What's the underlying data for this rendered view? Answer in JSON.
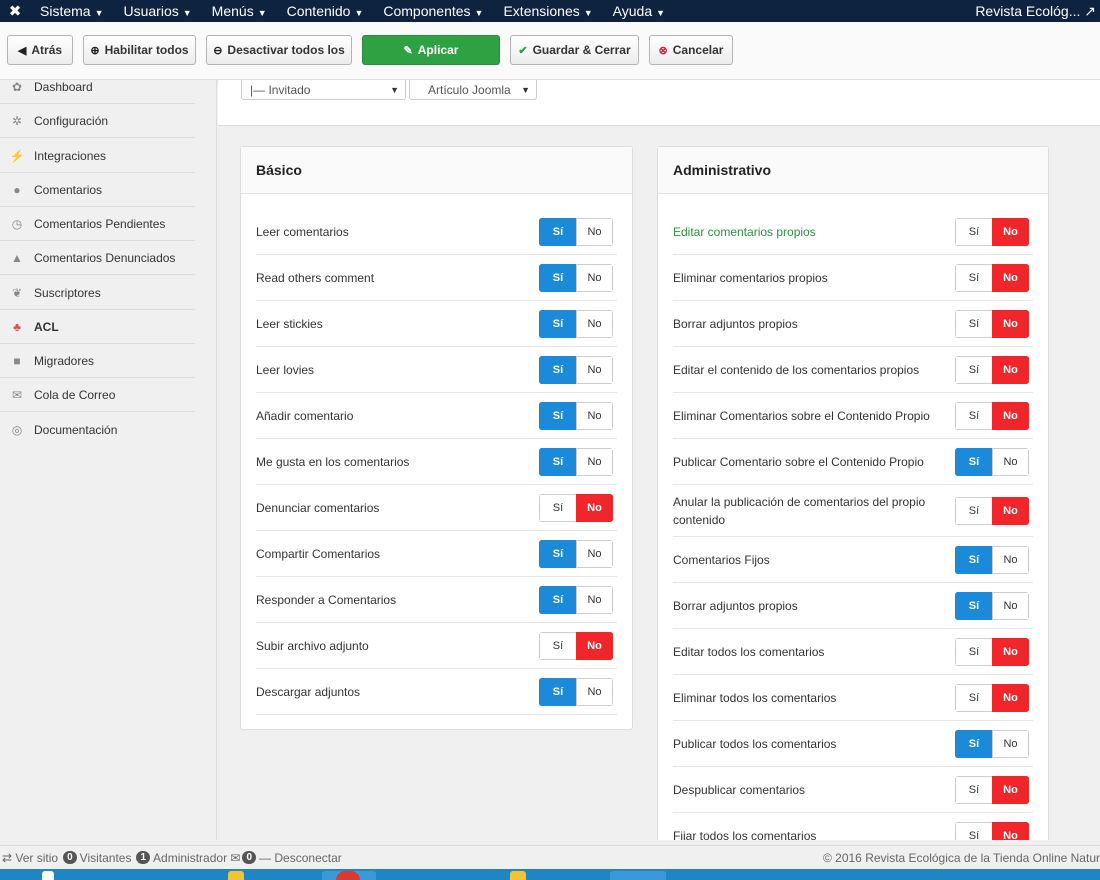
{
  "topnav": {
    "logo_icon": "joomla-icon",
    "menus": [
      "Sistema",
      "Usuarios",
      "Menús",
      "Contenido",
      "Componentes",
      "Extensiones",
      "Ayuda"
    ],
    "site_name": "Revista Ecológ...",
    "external_icon": "↗"
  },
  "toolbar": {
    "back": "Atrás",
    "enable_all": "Habilitar todos",
    "disable_all": "Desactivar todos los",
    "apply": "Aplicar",
    "save_close": "Guardar & Cerrar",
    "cancel": "Cancelar"
  },
  "sidebar": {
    "items": [
      {
        "label": "Dashboard",
        "icon": "dashboard-icon",
        "glyph": "✿"
      },
      {
        "label": "Configuración",
        "icon": "gear-icon",
        "glyph": "✲"
      },
      {
        "label": "Integraciones",
        "icon": "plug-icon",
        "glyph": "⚡"
      },
      {
        "label": "Comentarios",
        "icon": "comment-icon",
        "glyph": "●"
      },
      {
        "label": "Comentarios Pendientes",
        "icon": "clock-icon",
        "glyph": "◷"
      },
      {
        "label": "Comentarios Denunciados",
        "icon": "warning-icon",
        "glyph": "▲"
      },
      {
        "label": "Suscriptores",
        "icon": "leaf-icon",
        "glyph": "❦"
      },
      {
        "label": "ACL",
        "icon": "users-icon",
        "glyph": "♣"
      },
      {
        "label": "Migradores",
        "icon": "truck-icon",
        "glyph": "■"
      },
      {
        "label": "Cola de Correo",
        "icon": "mail-icon",
        "glyph": "✉"
      },
      {
        "label": "Documentación",
        "icon": "help-icon",
        "glyph": "◎"
      }
    ]
  },
  "filters": {
    "group": "|— Invitado",
    "content": "Artículo Joomla"
  },
  "basic": {
    "title": "Básico",
    "rows": [
      {
        "label": "Leer comentarios",
        "value": "si"
      },
      {
        "label": "Read others comment",
        "value": "si"
      },
      {
        "label": "Leer stickies",
        "value": "si"
      },
      {
        "label": "Leer lovies",
        "value": "si"
      },
      {
        "label": "Añadir comentario",
        "value": "si"
      },
      {
        "label": "Me gusta en los comentarios",
        "value": "si"
      },
      {
        "label": "Denunciar comentarios",
        "value": "no"
      },
      {
        "label": "Compartir Comentarios",
        "value": "si"
      },
      {
        "label": "Responder a Comentarios",
        "value": "si"
      },
      {
        "label": "Subir archivo adjunto",
        "value": "no"
      },
      {
        "label": "Descargar adjuntos",
        "value": "si"
      }
    ]
  },
  "admin": {
    "title": "Administrativo",
    "rows": [
      {
        "label": "Editar comentarios propios",
        "value": "no",
        "highlight": true
      },
      {
        "label": "Eliminar comentarios propios",
        "value": "no"
      },
      {
        "label": "Borrar adjuntos propios",
        "value": "no"
      },
      {
        "label": "Editar el contenido de los comentarios propios",
        "value": "no"
      },
      {
        "label": "Eliminar Comentarios sobre el Contenido Propio",
        "value": "no"
      },
      {
        "label": "Publicar Comentario sobre el Contenido Propio",
        "value": "si"
      },
      {
        "label": "Anular la publicación de comentarios del propio contenido",
        "value": "no"
      },
      {
        "label": "Comentarios Fijos",
        "value": "si"
      },
      {
        "label": "Borrar adjuntos propios",
        "value": "si"
      },
      {
        "label": "Editar todos los comentarios",
        "value": "no"
      },
      {
        "label": "Eliminar todos los comentarios",
        "value": "no"
      },
      {
        "label": "Publicar todos los comentarios",
        "value": "si"
      },
      {
        "label": "Despublicar comentarios",
        "value": "no"
      },
      {
        "label": "Fijar todos los comentarios",
        "value": "no"
      }
    ]
  },
  "toggle_labels": {
    "si": "Sí",
    "no": "No"
  },
  "statusbar": {
    "view_site": "Ver sitio",
    "visitors_count": "0",
    "visitors": "Visitantes",
    "admins_count": "1",
    "admins": "Administrador",
    "messages_count": "0",
    "logout": "Desconectar",
    "copyright": "© 2016 Revista Ecológica de la Tienda Online Natur"
  },
  "colors": {
    "accent_blue": "#1a8ad9",
    "no_red": "#f0262b",
    "apply_green": "#2ea143",
    "navbar": "#0d2340"
  }
}
